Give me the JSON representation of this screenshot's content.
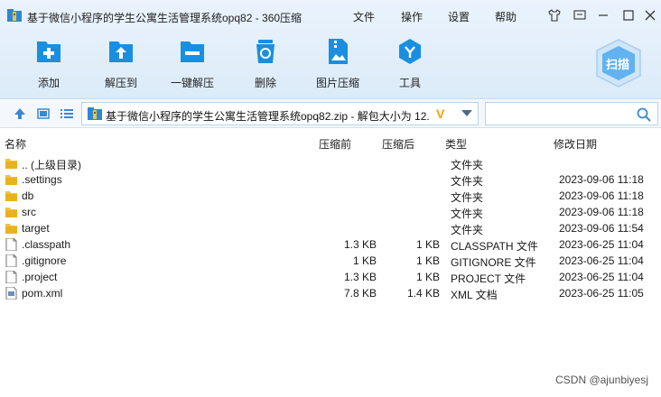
{
  "window": {
    "title": "基于微信小程序的学生公寓生活管理系统opq82 - 360压缩",
    "menu": [
      "文件",
      "操作",
      "设置",
      "帮助"
    ]
  },
  "toolbar": {
    "items": [
      {
        "label": "添加",
        "icon": "add-icon"
      },
      {
        "label": "解压到",
        "icon": "extract-to-icon"
      },
      {
        "label": "一键解压",
        "icon": "one-click-extract-icon"
      },
      {
        "label": "删除",
        "icon": "delete-icon"
      },
      {
        "label": "图片压缩",
        "icon": "image-compress-icon"
      },
      {
        "label": "工具",
        "icon": "tools-icon"
      }
    ],
    "scan_label": "扫描"
  },
  "address": {
    "path": "基于微信小程序的学生公寓生活管理系统opq82.zip - 解包大小为 12.",
    "badge": "V",
    "search_placeholder": ""
  },
  "columns": {
    "name": "名称",
    "packed": "压缩前",
    "size": "压缩后",
    "type": "类型",
    "modified": "修改日期"
  },
  "files": [
    {
      "name": ".. (上级目录)",
      "packed": "",
      "size": "",
      "type": "文件夹",
      "modified": "",
      "kind": "folder"
    },
    {
      "name": ".settings",
      "packed": "",
      "size": "",
      "type": "文件夹",
      "modified": "2023-09-06 11:18",
      "kind": "folder"
    },
    {
      "name": "db",
      "packed": "",
      "size": "",
      "type": "文件夹",
      "modified": "2023-09-06 11:18",
      "kind": "folder"
    },
    {
      "name": "src",
      "packed": "",
      "size": "",
      "type": "文件夹",
      "modified": "2023-09-06 11:18",
      "kind": "folder"
    },
    {
      "name": "target",
      "packed": "",
      "size": "",
      "type": "文件夹",
      "modified": "2023-09-06 11:54",
      "kind": "folder"
    },
    {
      "name": ".classpath",
      "packed": "1.3 KB",
      "size": "1 KB",
      "type": "CLASSPATH 文件",
      "modified": "2023-06-25 11:04",
      "kind": "file"
    },
    {
      "name": ".gitignore",
      "packed": "1 KB",
      "size": "1 KB",
      "type": "GITIGNORE 文件",
      "modified": "2023-06-25 11:04",
      "kind": "file"
    },
    {
      "name": ".project",
      "packed": "1.3 KB",
      "size": "1 KB",
      "type": "PROJECT 文件",
      "modified": "2023-06-25 11:04",
      "kind": "file"
    },
    {
      "name": "pom.xml",
      "packed": "7.8 KB",
      "size": "1.4 KB",
      "type": "XML 文档",
      "modified": "2023-06-25 11:05",
      "kind": "xml"
    }
  ],
  "watermark": "CSDN @ajunbiyesj",
  "colors": {
    "accent": "#1a8fe0",
    "folder": "#f3c23f",
    "toolbar_bg": "#dcebf9"
  }
}
